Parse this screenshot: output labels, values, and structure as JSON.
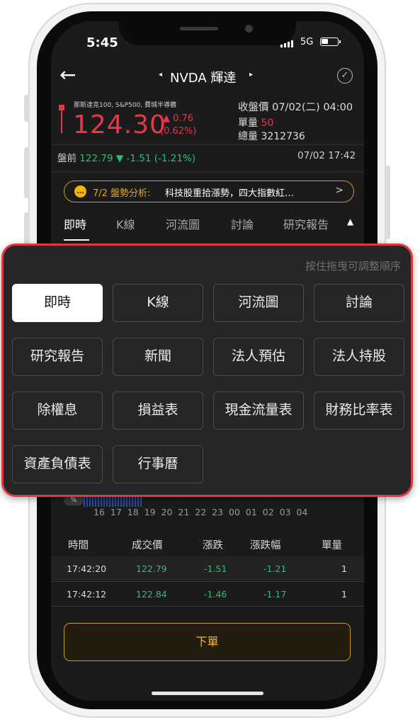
{
  "status_bar": {
    "time": "5:45",
    "network": "5G"
  },
  "header": {
    "prev_arrow": "◂",
    "ticker": "NVDA 輝達",
    "next_arrow": "▸"
  },
  "quote": {
    "indices": "那斯達克100, S&P500, 費城半導體",
    "price": "124.30",
    "change": "▲ 0.76",
    "change_pct": "(0.62%)",
    "close_label": "收盤價 07/02(二) 04:00",
    "unit_vol_label": "單量",
    "unit_vol_value": "50",
    "total_vol": "總量 3212736"
  },
  "premarket": {
    "label": "盤前",
    "price": "122.79",
    "change": "▼ -1.51",
    "change_pct": "(-1.21%)",
    "time": "07/02 17:42"
  },
  "analysis": {
    "icon": "speech-bubble-icon",
    "date": "7/2 盤勢分析:",
    "text": "科技股重拾漲勢，四大指數紅…",
    "arrow": ">"
  },
  "tabs": [
    "即時",
    "K線",
    "河流圖",
    "討論",
    "研究報告"
  ],
  "tabs_toggle": "▲",
  "reorder_panel": {
    "hint": "按住拖曳可調整順序",
    "items": [
      "即時",
      "K線",
      "河流圖",
      "討論",
      "研究報告",
      "新聞",
      "法人預估",
      "法人持股",
      "除權息",
      "損益表",
      "現金流量表",
      "財務比率表",
      "資產負債表",
      "行事曆"
    ],
    "active_index": 0
  },
  "chart_axis": {
    "marker": "%",
    "ticks": "16 17 18 19 20 21 22 23 00 01 02 03 04"
  },
  "trades": {
    "headers": [
      "時間",
      "成交價",
      "漲跌",
      "漲跌幅",
      "單量"
    ],
    "rows": [
      [
        "17:42:20",
        "122.79",
        "-1.51",
        "-1.21",
        "1"
      ],
      [
        "17:42:12",
        "122.84",
        "-1.46",
        "-1.17",
        "1"
      ]
    ]
  },
  "order_button": "下單",
  "colors": {
    "up": "#e5394a",
    "down": "#2dbf78",
    "accent": "#c99a23",
    "popup_border": "#e0383f"
  }
}
